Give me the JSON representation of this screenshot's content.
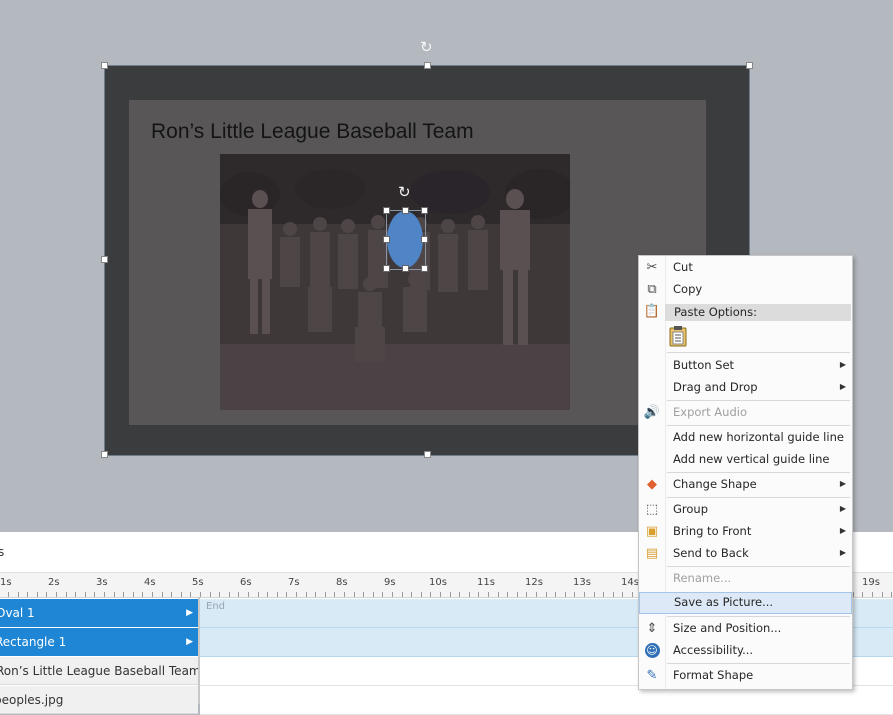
{
  "slide": {
    "title": "Ron’s Little League Baseball Team"
  },
  "timeline": {
    "header": "s",
    "ruler_ticks": [
      "1s",
      "2s",
      "3s",
      "4s",
      "5s",
      "6s",
      "7s",
      "8s",
      "9s",
      "10s",
      "11s",
      "12s",
      "13s",
      "14s",
      "19s"
    ],
    "end_label": "End",
    "rows": [
      {
        "label": "Oval 1",
        "selected": true
      },
      {
        "label": "Rectangle 1",
        "selected": true
      },
      {
        "label": "Ron’s Little League Baseball Team",
        "selected": false
      },
      {
        "label": "peoples.jpg",
        "selected": false
      }
    ]
  },
  "context_menu": {
    "cut": "Cut",
    "copy": "Copy",
    "paste_options": "Paste Options:",
    "button_set": "Button Set",
    "drag_and_drop": "Drag and Drop",
    "export_audio": "Export Audio",
    "add_horizontal_guide": "Add new horizontal guide line",
    "add_vertical_guide": "Add new vertical guide line",
    "change_shape": "Change Shape",
    "group": "Group",
    "bring_to_front": "Bring to Front",
    "send_to_back": "Send to Back",
    "rename": "Rename...",
    "save_as_picture": "Save as Picture...",
    "size_and_position": "Size and Position...",
    "accessibility": "Accessibility...",
    "format_shape": "Format Shape"
  },
  "colors": {
    "canvas_bg": "#b4b9bf",
    "selected_row": "#1e86d4",
    "oval_fill": "#4f84c6",
    "menu_highlight": "#dde9f6"
  }
}
